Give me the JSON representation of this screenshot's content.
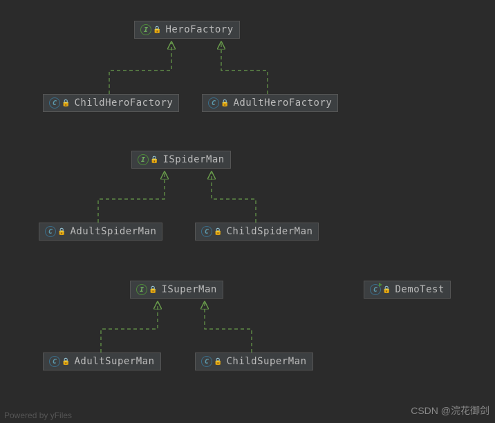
{
  "nodes": {
    "heroFactory": {
      "label": "HeroFactory",
      "type": "interface"
    },
    "childHeroFactory": {
      "label": "ChildHeroFactory",
      "type": "class"
    },
    "adultHeroFactory": {
      "label": "AdultHeroFactory",
      "type": "class"
    },
    "iSpiderMan": {
      "label": "ISpiderMan",
      "type": "interface"
    },
    "adultSpiderMan": {
      "label": "AdultSpiderMan",
      "type": "class"
    },
    "childSpiderMan": {
      "label": "ChildSpiderMan",
      "type": "class"
    },
    "iSuperMan": {
      "label": "ISuperMan",
      "type": "interface"
    },
    "adultSuperMan": {
      "label": "AdultSuperMan",
      "type": "class"
    },
    "childSuperMan": {
      "label": "ChildSuperMan",
      "type": "class"
    },
    "demoTest": {
      "label": "DemoTest",
      "type": "runnable-class"
    }
  },
  "icons": {
    "interface": "I",
    "class": "C",
    "runnable-class": "C",
    "lock": "🔒"
  },
  "watermarks": {
    "bottomLeft": "Powered by yFiles",
    "bottomRight": "CSDN @浣花御剑"
  },
  "chart_data": {
    "type": "diagram",
    "title": "",
    "edges": [
      {
        "from": "ChildHeroFactory",
        "to": "HeroFactory",
        "relation": "implements"
      },
      {
        "from": "AdultHeroFactory",
        "to": "HeroFactory",
        "relation": "implements"
      },
      {
        "from": "AdultSpiderMan",
        "to": "ISpiderMan",
        "relation": "implements"
      },
      {
        "from": "ChildSpiderMan",
        "to": "ISpiderMan",
        "relation": "implements"
      },
      {
        "from": "AdultSuperMan",
        "to": "ISuperMan",
        "relation": "implements"
      },
      {
        "from": "ChildSuperMan",
        "to": "ISuperMan",
        "relation": "implements"
      }
    ],
    "standalone": [
      "DemoTest"
    ]
  }
}
